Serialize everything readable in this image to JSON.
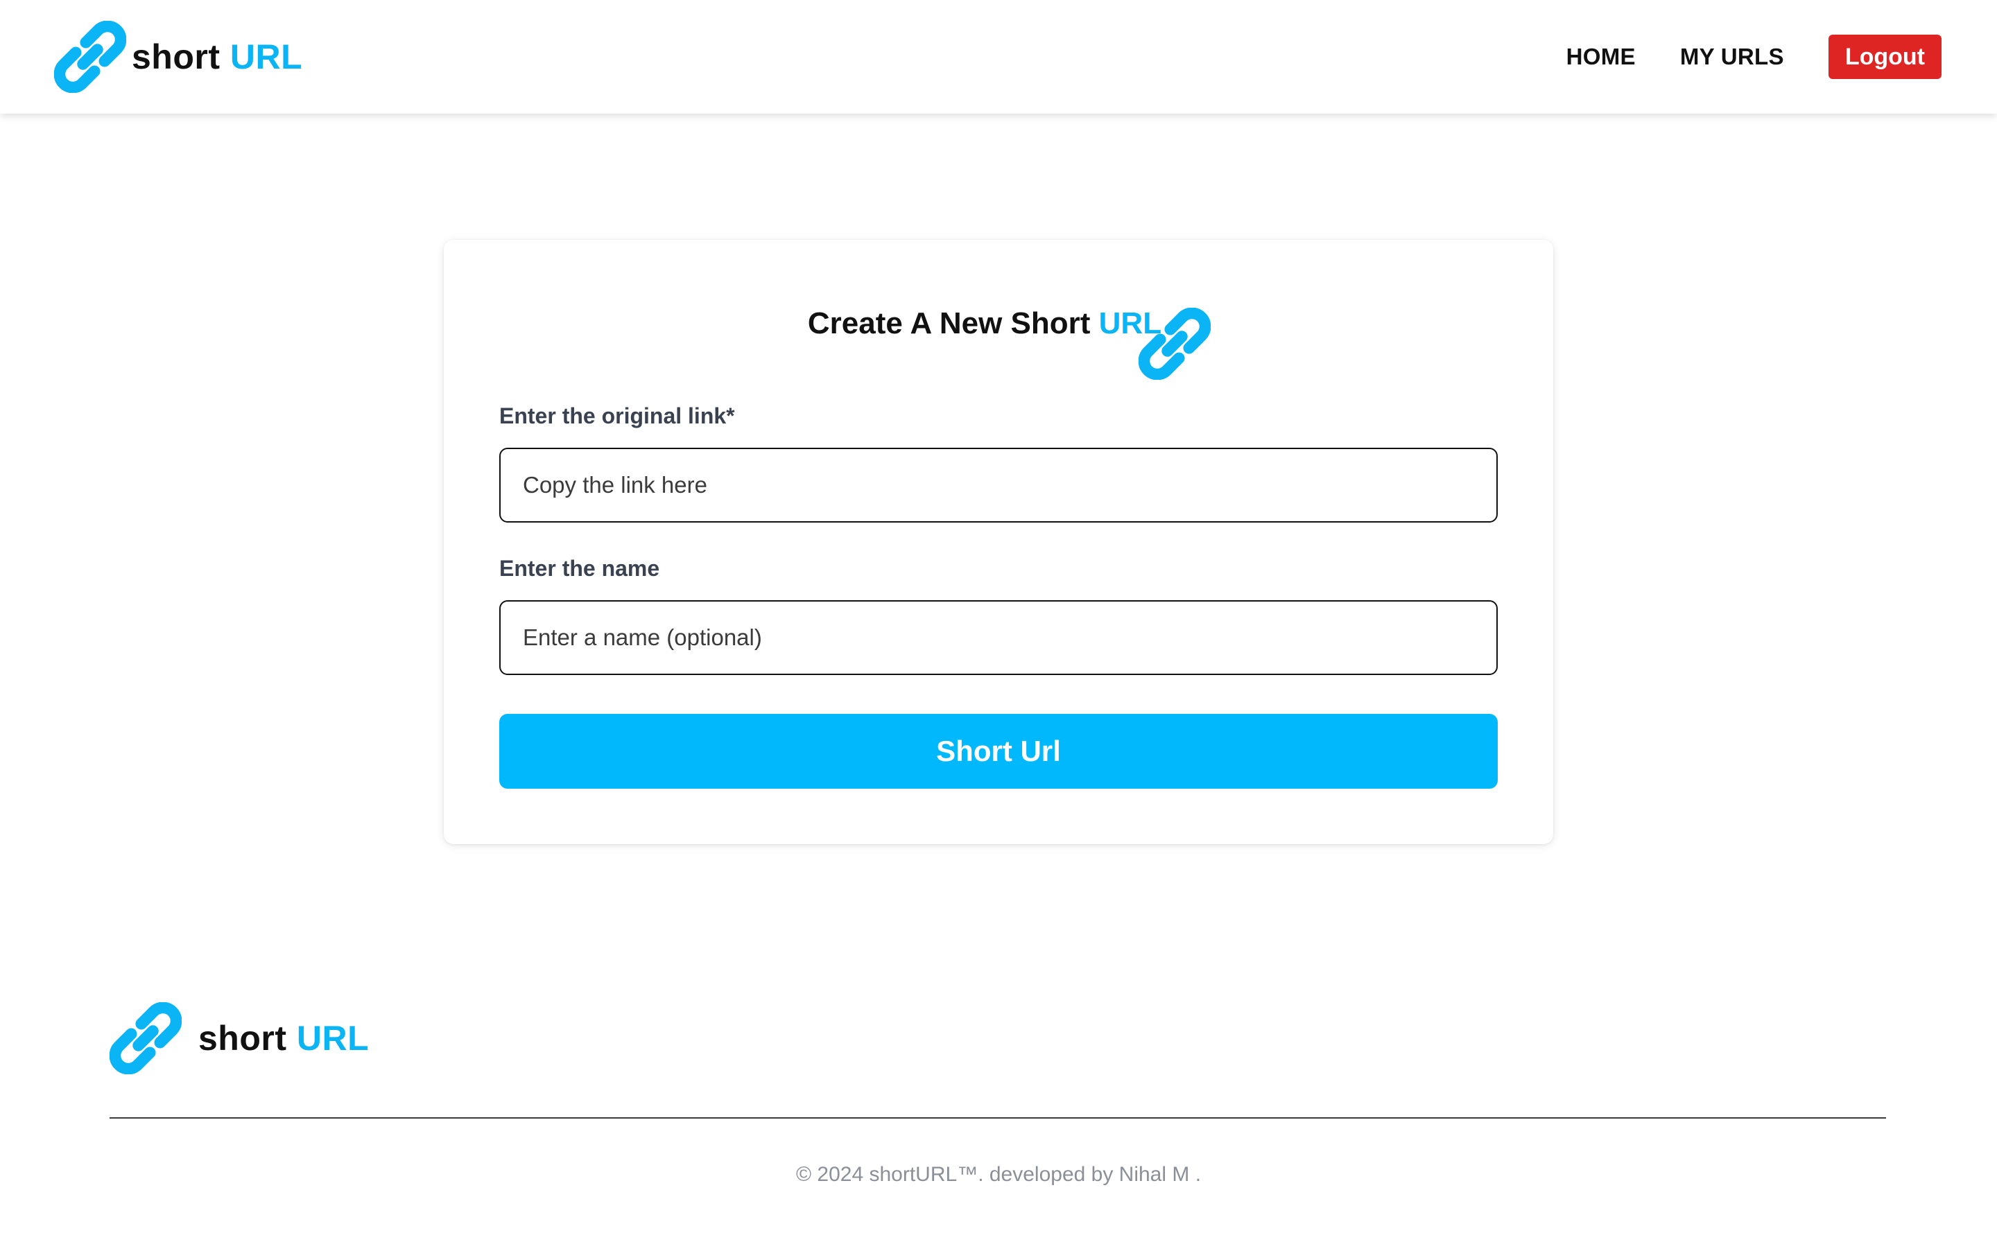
{
  "header": {
    "brand": {
      "text": "short",
      "accent": "URL"
    },
    "nav": {
      "home": "HOME",
      "my_urls": "MY URLS",
      "logout": "Logout"
    }
  },
  "form": {
    "title": "Create A New Short",
    "title_accent": "URL",
    "original_link": {
      "label": "Enter the original link*",
      "placeholder": "Copy the link here",
      "value": ""
    },
    "name": {
      "label": "Enter the name",
      "placeholder": "Enter a name (optional)",
      "value": ""
    },
    "submit_label": "Short Url"
  },
  "footer": {
    "brand": {
      "text": "short",
      "accent": "URL"
    },
    "copyright": "© 2024 shortURL™. developed by Nihal M ."
  },
  "icons": {
    "brand": "link-chain-icon"
  },
  "colors": {
    "accent": "#0bb4f5",
    "button": "#00b8fb",
    "logout": "#df2424",
    "text": "#111111"
  }
}
